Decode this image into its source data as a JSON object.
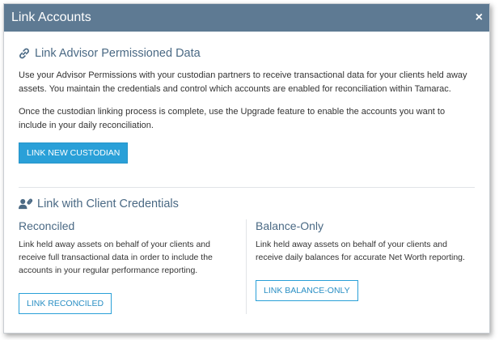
{
  "dialog": {
    "title": "Link Accounts",
    "close_label": "×"
  },
  "advisor": {
    "heading": "Link Advisor Permissioned Data",
    "icon": "link-icon",
    "paragraph1": "Use your Advisor Permissions with your custodian partners to receive transactional data for your clients held away assets. You maintain the credentials and control which accounts are enabled for reconciliation within Tamarac.",
    "paragraph2": "Once the custodian linking process is complete, use the Upgrade feature to enable the accounts you want to include in your daily reconciliation.",
    "button_label": "LINK NEW CUSTODIAN"
  },
  "client": {
    "heading": "Link with Client Credentials",
    "icon": "user-link-icon",
    "reconciled": {
      "title": "Reconciled",
      "text": "Link held away assets on behalf of your clients and receive full transactional data in order to include the accounts in your regular performance reporting.",
      "button_label": "LINK RECONCILED"
    },
    "balance_only": {
      "title": "Balance-Only",
      "text": "Link held away assets on behalf of your clients and receive daily balances for accurate Net Worth reporting.",
      "button_label": "LINK BALANCE-ONLY"
    }
  },
  "colors": {
    "titlebar": "#5e7a93",
    "heading": "#4a6984",
    "primary": "#2aa0d8"
  }
}
